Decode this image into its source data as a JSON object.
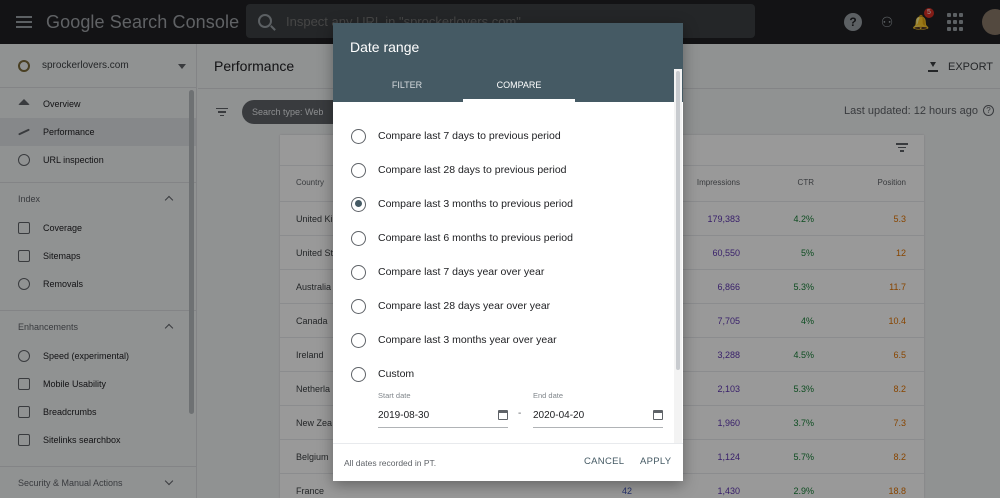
{
  "app": {
    "brand": "Google Search Console",
    "search_placeholder": "Inspect any URL in \"sprockerlovers.com\"",
    "notification_count": "5"
  },
  "sidebar": {
    "property": "sprockerlovers.com",
    "items_top": [
      {
        "label": "Overview",
        "icon": "home-icon"
      },
      {
        "label": "Performance",
        "icon": "trending-up-icon",
        "active": true
      },
      {
        "label": "URL inspection",
        "icon": "search-icon"
      }
    ],
    "index_label": "Index",
    "index_items": [
      {
        "label": "Coverage",
        "icon": "coverage-icon"
      },
      {
        "label": "Sitemaps",
        "icon": "sitemap-icon"
      },
      {
        "label": "Removals",
        "icon": "removals-icon"
      }
    ],
    "enhancements_label": "Enhancements",
    "enhancement_items": [
      {
        "label": "Speed (experimental)",
        "icon": "speed-icon"
      },
      {
        "label": "Mobile Usability",
        "icon": "phone-icon"
      },
      {
        "label": "Breadcrumbs",
        "icon": "layers-icon"
      },
      {
        "label": "Sitelinks searchbox",
        "icon": "layers-icon"
      }
    ],
    "security_label": "Security & Manual Actions"
  },
  "main": {
    "title": "Performance",
    "export_label": "EXPORT",
    "chip_label": "Search type: Web",
    "last_updated": "Last updated: 12 hours ago"
  },
  "table": {
    "headers": {
      "country": "Country",
      "impressions": "Impressions",
      "ctr": "CTR",
      "position": "Position"
    },
    "rows": [
      {
        "country": "United Ki",
        "clicks": "",
        "impressions": "179,383",
        "ctr": "4.2%",
        "position": "5.3"
      },
      {
        "country": "United St",
        "clicks": "",
        "impressions": "60,550",
        "ctr": "5%",
        "position": "12"
      },
      {
        "country": "Australia",
        "clicks": "",
        "impressions": "6,866",
        "ctr": "5.3%",
        "position": "11.7"
      },
      {
        "country": "Canada",
        "clicks": "",
        "impressions": "7,705",
        "ctr": "4%",
        "position": "10.4"
      },
      {
        "country": "Ireland",
        "clicks": "",
        "impressions": "3,288",
        "ctr": "4.5%",
        "position": "6.5"
      },
      {
        "country": "Netherla",
        "clicks": "",
        "impressions": "2,103",
        "ctr": "5.3%",
        "position": "8.2"
      },
      {
        "country": "New Zea",
        "clicks": "",
        "impressions": "1,960",
        "ctr": "3.7%",
        "position": "7.3"
      },
      {
        "country": "Belgium",
        "clicks": "",
        "impressions": "1,124",
        "ctr": "5.7%",
        "position": "8.2"
      },
      {
        "country": "France",
        "clicks": "42",
        "impressions": "1,430",
        "ctr": "2.9%",
        "position": "18.8"
      }
    ]
  },
  "dialog": {
    "title": "Date range",
    "tabs": [
      "FILTER",
      "COMPARE"
    ],
    "active_tab": "COMPARE",
    "options": [
      {
        "label": "Compare last 7 days to previous period",
        "checked": false
      },
      {
        "label": "Compare last 28 days to previous period",
        "checked": false
      },
      {
        "label": "Compare last 3 months to previous period",
        "checked": true
      },
      {
        "label": "Compare last 6 months to previous period",
        "checked": false
      },
      {
        "label": "Compare last 7 days year over year",
        "checked": false
      },
      {
        "label": "Compare last 28 days year over year",
        "checked": false
      },
      {
        "label": "Compare last 3 months year over year",
        "checked": false
      },
      {
        "label": "Custom",
        "checked": false
      }
    ],
    "start_date_label": "Start date",
    "start_date": "2019-08-30",
    "end_date_label": "End date",
    "end_date": "2020-04-20",
    "date_separator": "-",
    "footer_note": "All dates recorded in PT.",
    "cancel_label": "CANCEL",
    "apply_label": "APPLY",
    "header_color": "#455a64"
  }
}
